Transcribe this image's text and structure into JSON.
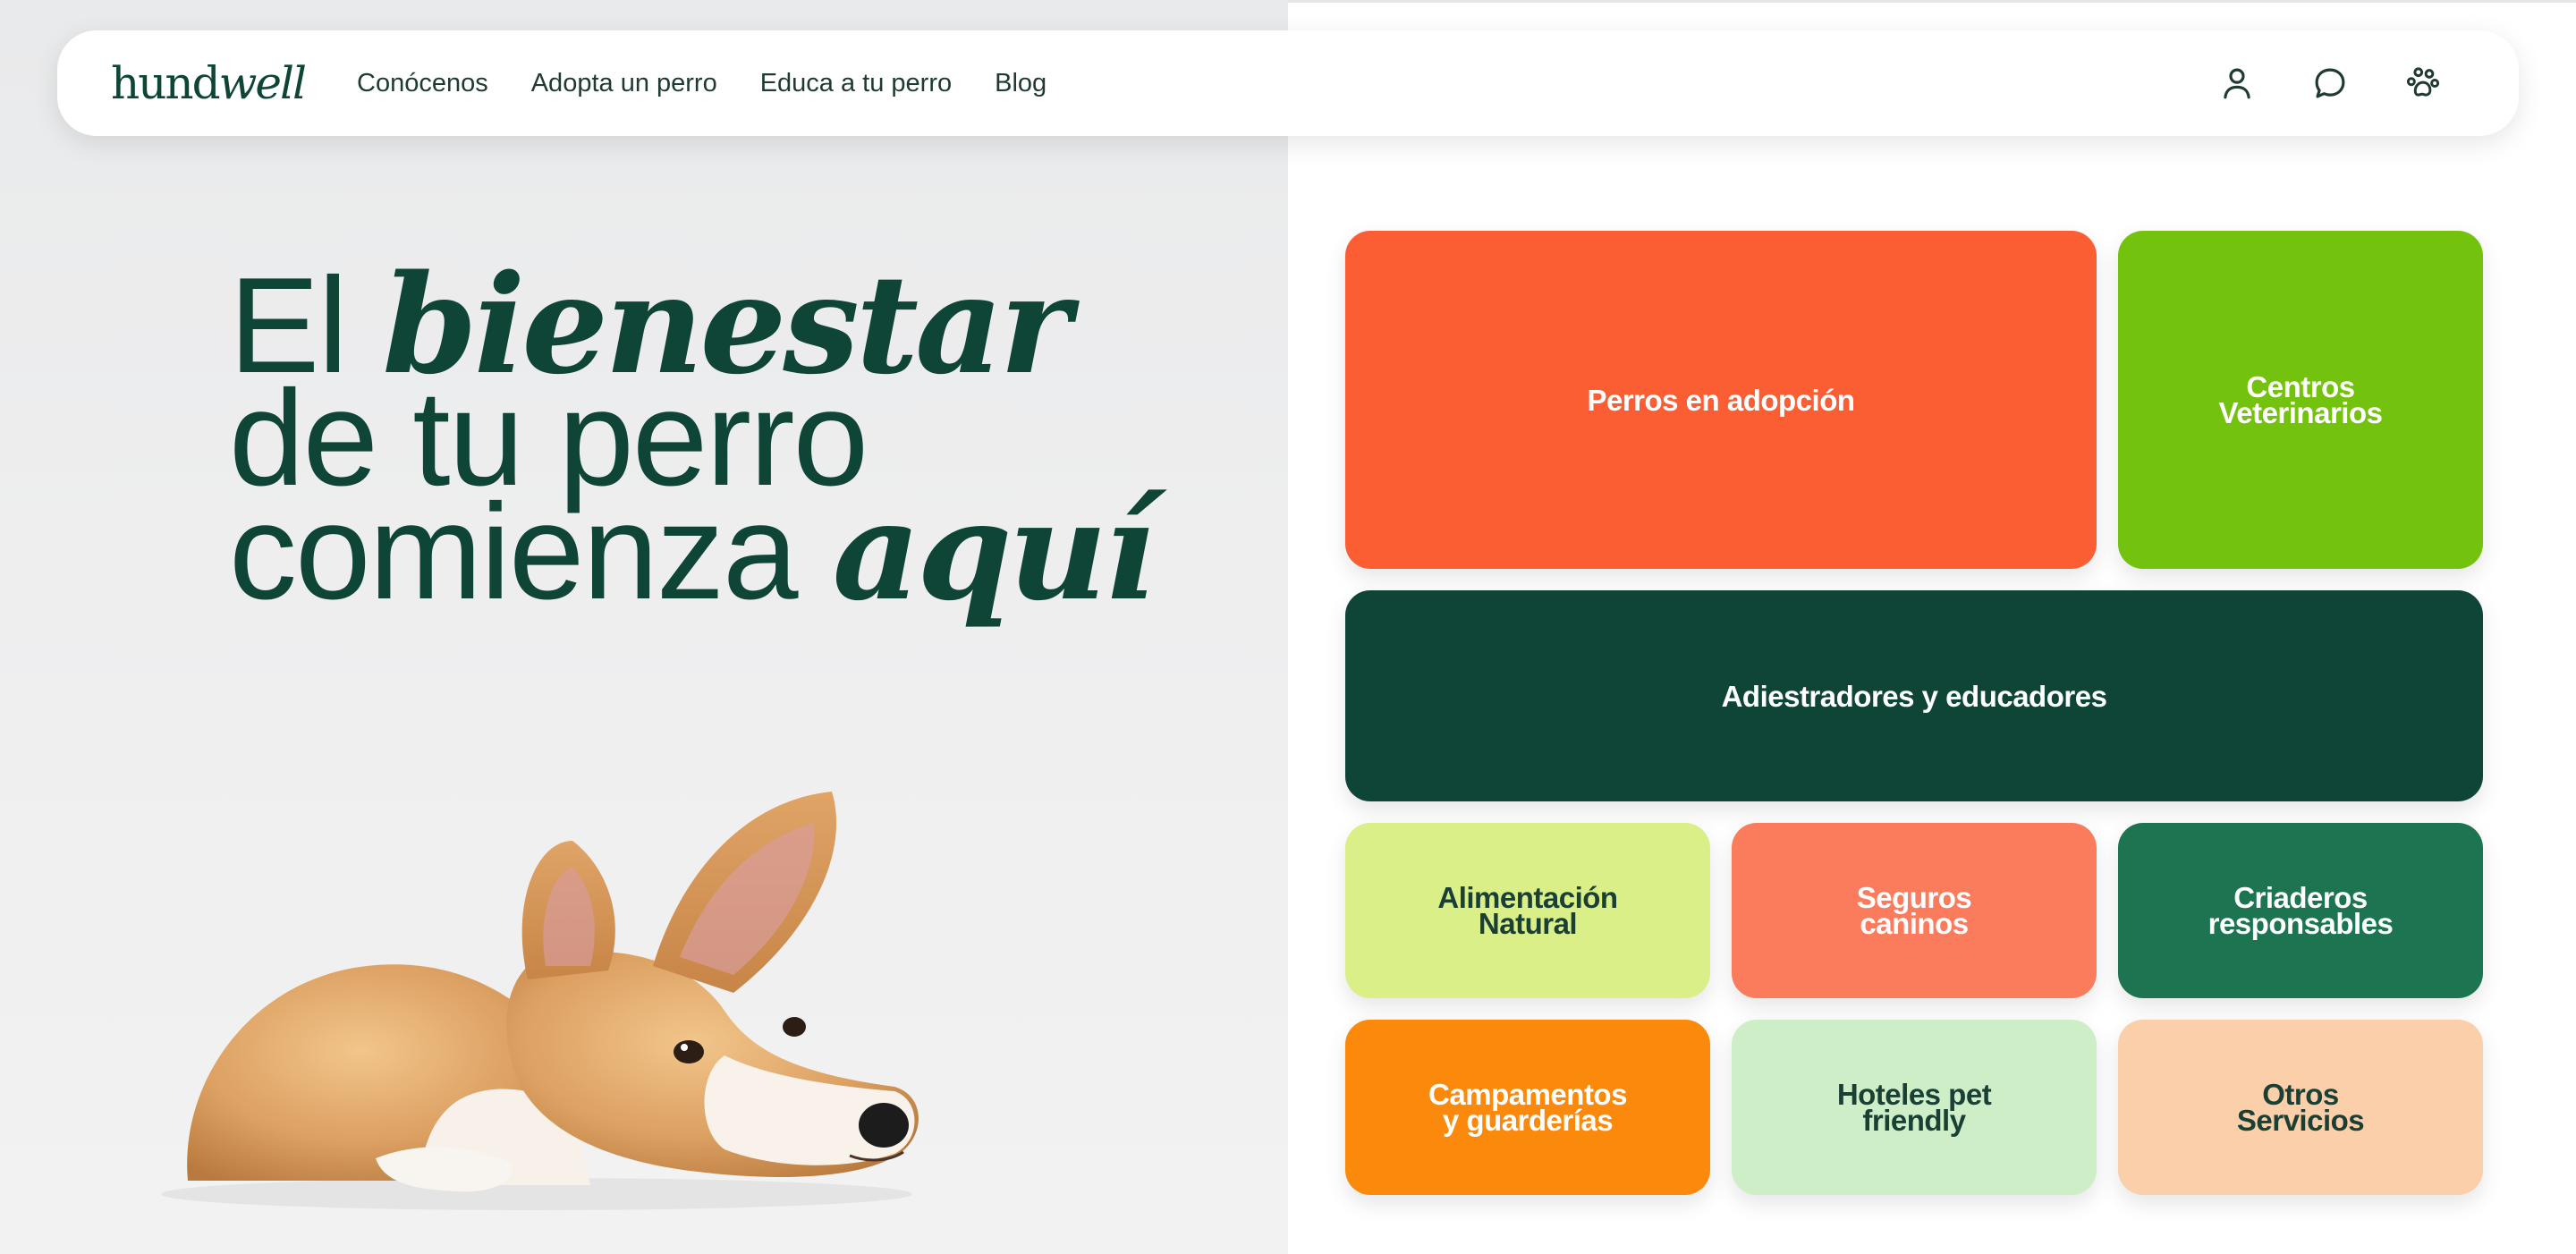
{
  "brand": {
    "logo_part1": "hund",
    "logo_part2": "well",
    "color": "#0e4537"
  },
  "nav": {
    "links": [
      "Conócenos",
      "Adopta un perro",
      "Educa a tu perro",
      "Blog"
    ],
    "icons": [
      "user-icon",
      "chat-bubble-icon",
      "paw-icon"
    ]
  },
  "hero": {
    "line1_a": "El ",
    "line1_b": "bienestar",
    "line2": "de tu perro",
    "line3_a": "comienza ",
    "line3_b": "aquí",
    "image_alt": "corgi-lying-down"
  },
  "tiles": [
    {
      "label": "Perros en adopción",
      "color": "#fc5e34"
    },
    {
      "label": "Centros\nVeterinarios",
      "color": "#73c20e"
    },
    {
      "label": "Adiestradores y educadores",
      "color": "#0e4537"
    },
    {
      "label": "Alimentación\nNatural",
      "color": "#dbef89"
    },
    {
      "label": "Seguros\ncaninos",
      "color": "#fb7c5c"
    },
    {
      "label": "Criaderos\nresponsables",
      "color": "#1d7451"
    },
    {
      "label": "Campamentos\ny guarderías",
      "color": "#fb890c"
    },
    {
      "label": "Hoteles pet\nfriendly",
      "color": "#cdeec7"
    },
    {
      "label": "Otros\nServicios",
      "color": "#fbcfa9"
    }
  ]
}
